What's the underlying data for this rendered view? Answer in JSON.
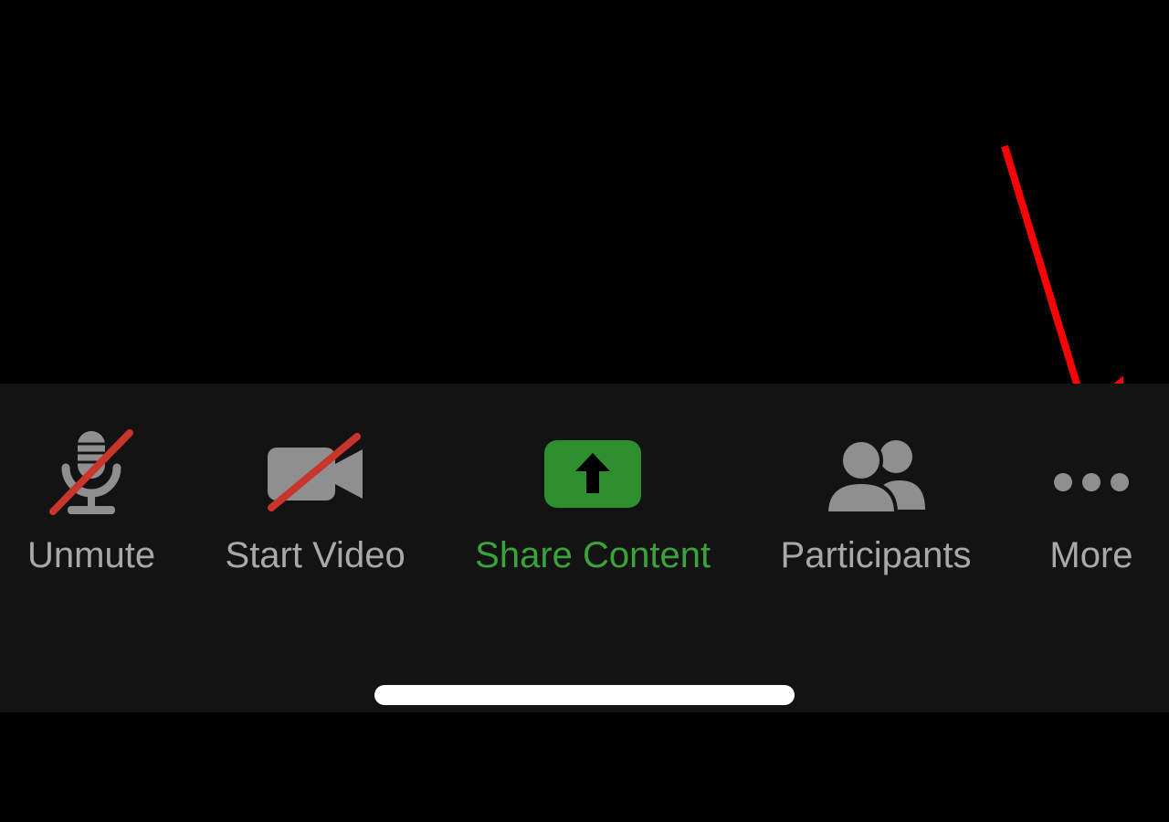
{
  "toolbar": {
    "unmute_label": "Unmute",
    "start_video_label": "Start Video",
    "share_content_label": "Share Content",
    "participants_label": "Participants",
    "more_label": "More"
  },
  "colors": {
    "toolbar_bg": "#131313",
    "icon_gray": "#8f8f8f",
    "label_gray": "#a9a9a9",
    "share_green": "#3aa33a",
    "share_icon_green": "#2e8f2e",
    "slash_red": "#c9352c",
    "arrow_red": "#fb0207"
  }
}
